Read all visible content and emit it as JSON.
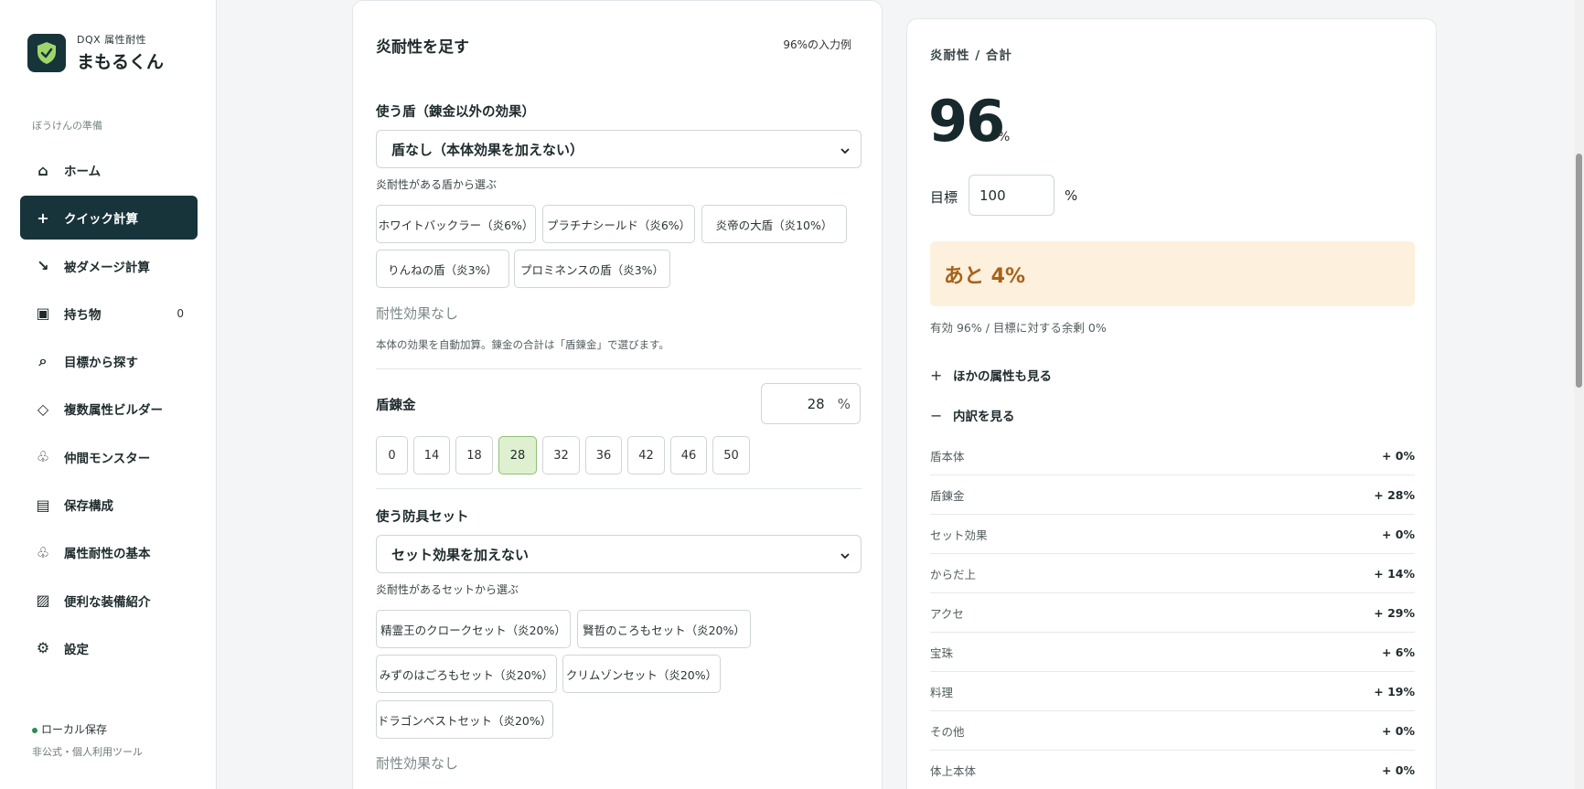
{
  "sidebar": {
    "logo_sub": "DQX 属性耐性",
    "logo_main": "まもるくん",
    "section": "ぼうけんの準備",
    "items": [
      {
        "label": "ホーム",
        "icon": "home-icon",
        "glyph": "⌂"
      },
      {
        "label": "クイック計算",
        "icon": "plus-icon",
        "glyph": "+"
      },
      {
        "label": "被ダメージ計算",
        "icon": "diagonal-arrow-icon",
        "glyph": "↘"
      },
      {
        "label": "持ち物",
        "icon": "square-icon",
        "glyph": "▣",
        "count": "0"
      },
      {
        "label": "目標から探す",
        "icon": "search-icon",
        "glyph": "⌕"
      },
      {
        "label": "複数属性ビルダー",
        "icon": "diamond-icon",
        "glyph": "◇"
      },
      {
        "label": "仲間モンスター",
        "icon": "club-icon",
        "glyph": "♧"
      },
      {
        "label": "保存構成",
        "icon": "list-icon",
        "glyph": "▤"
      },
      {
        "label": "属性耐性の基本",
        "icon": "club-icon",
        "glyph": "♧"
      },
      {
        "label": "便利な装備紹介",
        "icon": "hatch-icon",
        "glyph": "▨"
      },
      {
        "label": "設定",
        "icon": "gear-icon",
        "glyph": "⚙"
      }
    ],
    "footer_status": "ローカル保存",
    "footer_note": "非公式・個人利用ツール",
    "status_color": "#2e8b57"
  },
  "card": {
    "title": "炎耐性を足す",
    "example": "96%の入力例",
    "shield_label": "使う盾（錬金以外の効果）",
    "shield_value": "盾なし（本体効果を加えない）",
    "shield_sub": "炎耐性がある盾から選ぶ",
    "shield_chips": [
      "ホワイトバックラー（炎6%）",
      "プラチナシールド（炎6%）",
      "炎帝の大盾（炎10%）",
      "りんねの盾（炎3%）",
      "プロミネンスの盾（炎3%）"
    ],
    "shield_none": "耐性効果なし",
    "shield_note": "本体の効果を自動加算。錬金の合計は「盾錬金」で選びます。",
    "alchemy_label": "盾錬金",
    "alchemy_value": "28",
    "alchemy_unit": "%",
    "alchemy_options": [
      "0",
      "14",
      "18",
      "28",
      "32",
      "36",
      "42",
      "46",
      "50"
    ],
    "alchemy_selected": "28",
    "set_label": "使う防具セット",
    "set_value": "セット効果を加えない",
    "set_sub": "炎耐性があるセットから選ぶ",
    "set_chips": [
      "精霊王のクロークセット（炎20%）",
      "賢哲のころもセット（炎20%）",
      "みずのはごろもセット（炎20%）",
      "クリムゾンセット（炎20%）",
      "ドラゴンベストセット（炎20%）"
    ],
    "set_none": "耐性効果なし"
  },
  "panel": {
    "heading": "炎耐性 / 合計",
    "total": "96",
    "total_unit": "%",
    "target_label": "目標",
    "target_value": "100",
    "target_unit": "%",
    "remaining": "あと 4%",
    "effective": "有効 96% / 目標に対する余剰 0%",
    "other_toggle": "ほかの属性も見る",
    "breakdown_toggle": "内訳を見る",
    "breakdown": [
      {
        "k": "盾本体",
        "v": "+ 0%"
      },
      {
        "k": "盾錬金",
        "v": "+ 28%"
      },
      {
        "k": "セット効果",
        "v": "+ 0%"
      },
      {
        "k": "からだ上",
        "v": "+ 14%"
      },
      {
        "k": "アクセ",
        "v": "+ 29%"
      },
      {
        "k": "宝珠",
        "v": "+ 6%"
      },
      {
        "k": "料理",
        "v": "+ 19%"
      },
      {
        "k": "その他",
        "v": "+ 0%"
      },
      {
        "k": "体上本体",
        "v": "+ 0%"
      }
    ],
    "accent_color": "#17343a",
    "remain_bg": "#fdf0dc"
  }
}
